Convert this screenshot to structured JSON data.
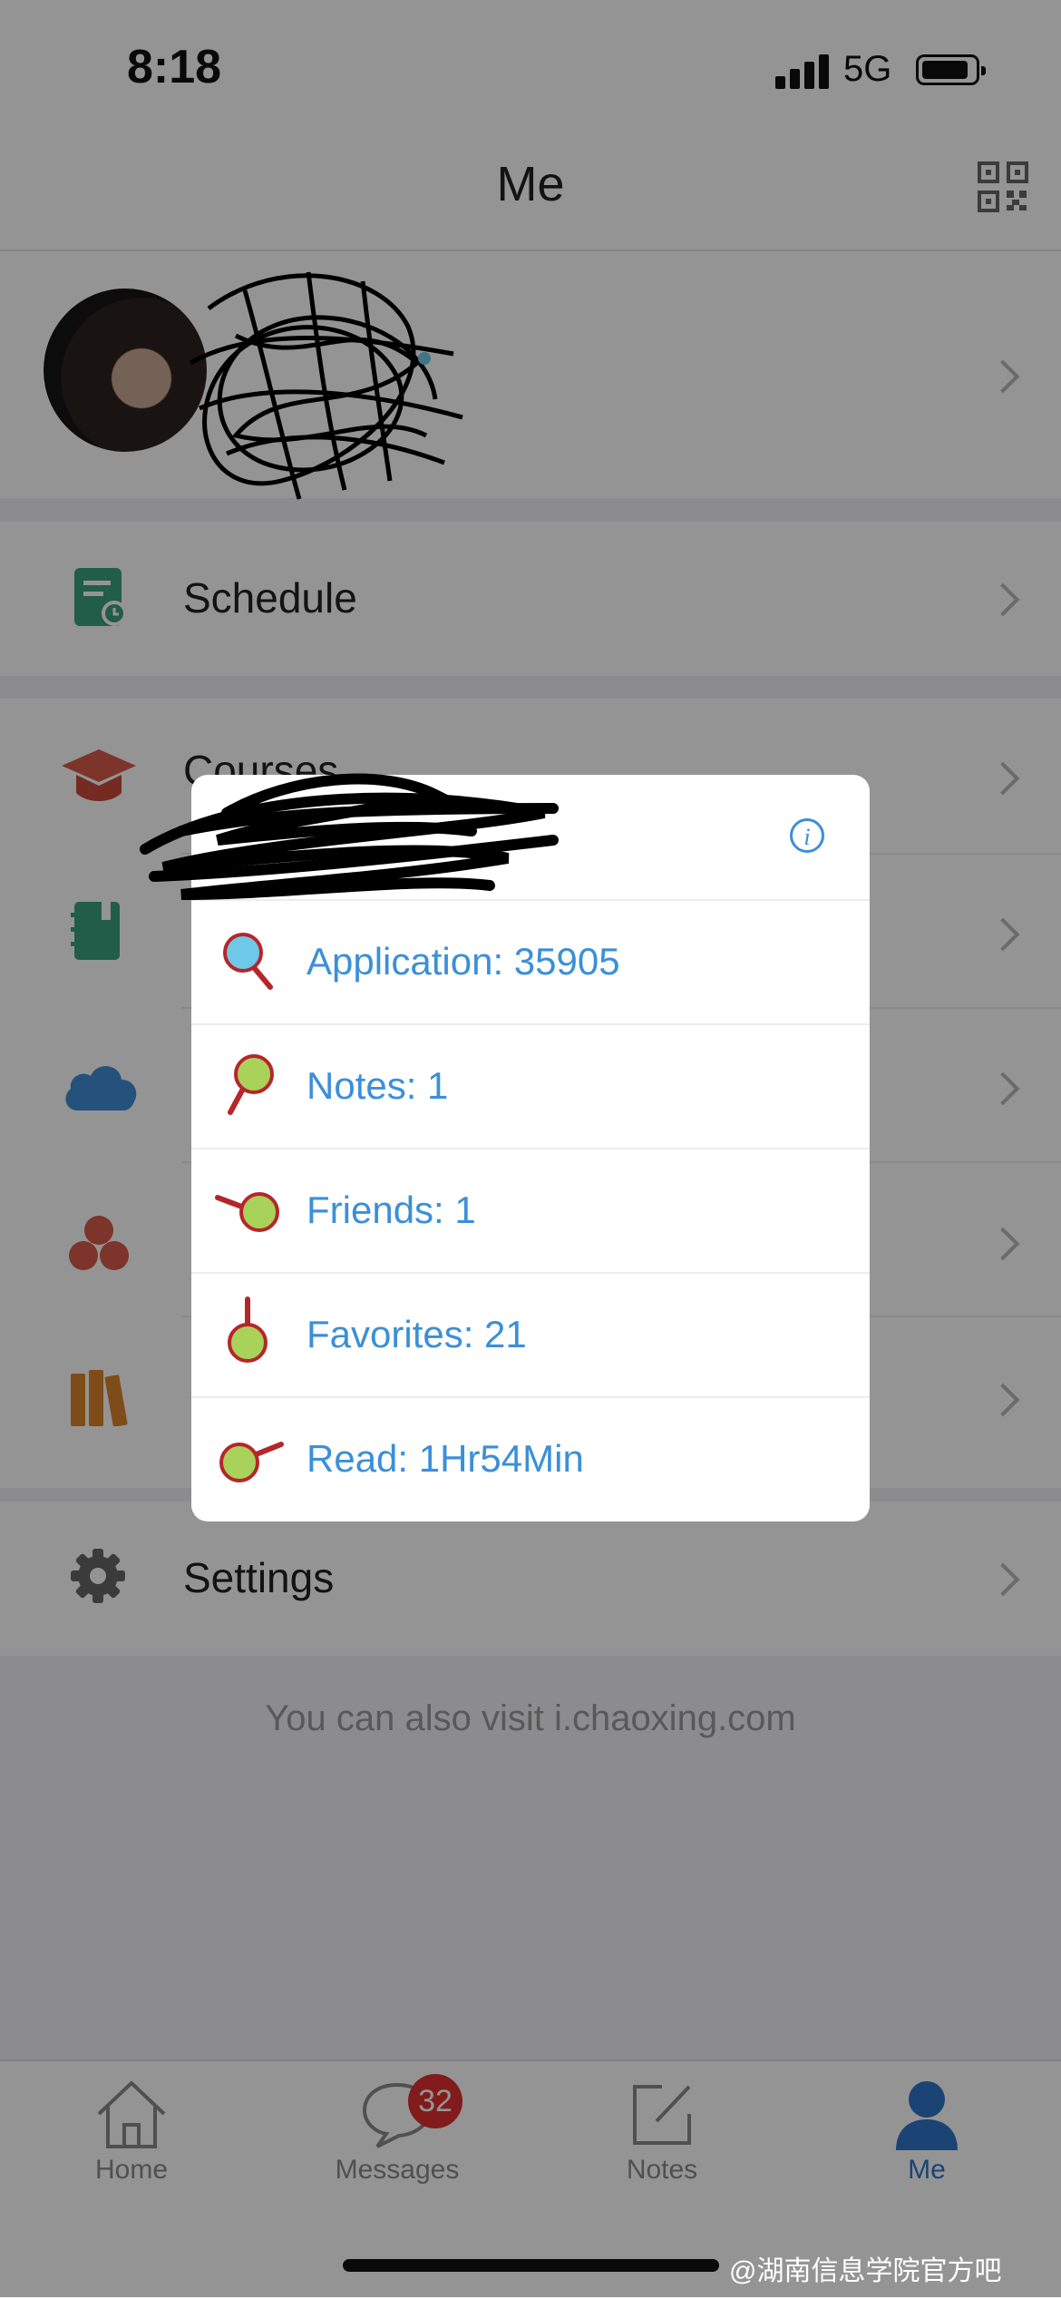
{
  "status_bar": {
    "time": "8:18",
    "network": "5G"
  },
  "nav": {
    "title": "Me"
  },
  "menu": {
    "schedule": "Schedule",
    "courses": "Courses",
    "settings": "Settings"
  },
  "footer_hint": "You can also visit i.chaoxing.com",
  "tabs": [
    {
      "label": "Home",
      "icon": "home-icon"
    },
    {
      "label": "Messages",
      "icon": "chat-bubble-icon",
      "badge": "32"
    },
    {
      "label": "Notes",
      "icon": "edit-icon"
    },
    {
      "label": "Me",
      "icon": "person-icon",
      "active": true
    }
  ],
  "popup": {
    "stats": [
      {
        "label": "Application: 35905",
        "icon": "magnifier-icon"
      },
      {
        "label": "Notes: 1",
        "icon": "pin-icon"
      },
      {
        "label": "Friends: 1",
        "icon": "pin-left-icon"
      },
      {
        "label": "Favorites: 21",
        "icon": "drop-pin-icon"
      },
      {
        "label": "Read: 1Hr54Min",
        "icon": "pin-right-icon"
      }
    ]
  },
  "watermark": "@湖南信息学院官方吧",
  "colors": {
    "accent": "#3b8fd8",
    "active_tab": "#2f74c9",
    "badge": "#e0302f",
    "pin_red": "#b5262b",
    "pin_green": "#a8d25a",
    "pin_blue": "#6ec8e8"
  }
}
